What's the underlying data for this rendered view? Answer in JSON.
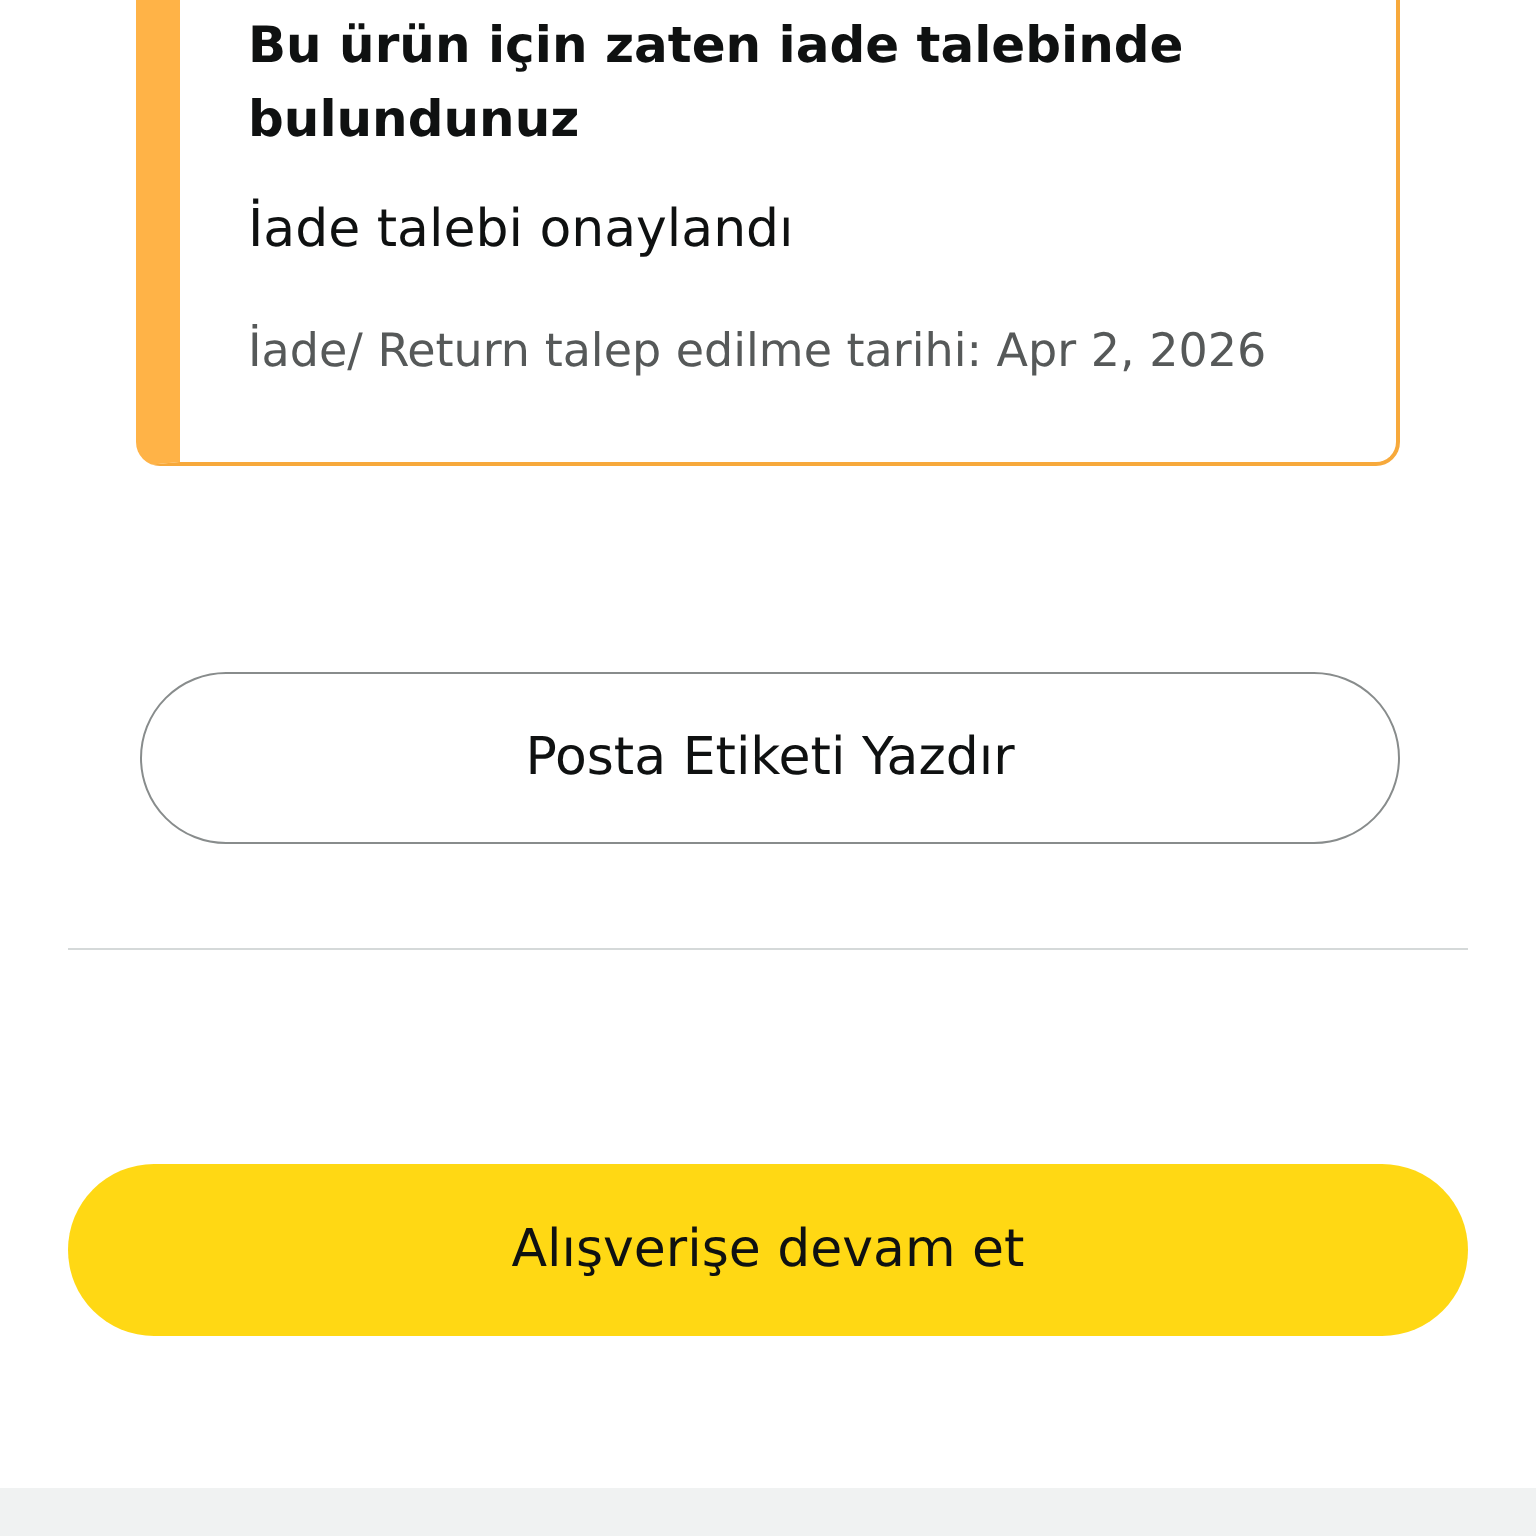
{
  "return_notice": {
    "title": "Bu ürün için zaten iade talebinde bulundunuz",
    "status": "İade talebi onaylandı",
    "date_text": "İade/ Return talep edilme tarihi: Apr 2, 2026"
  },
  "buttons": [
    {
      "kind": "outline",
      "label": "Posta Etiketi Yazdır"
    },
    {
      "kind": "primary",
      "label": "Alışverişe devam et"
    }
  ]
}
